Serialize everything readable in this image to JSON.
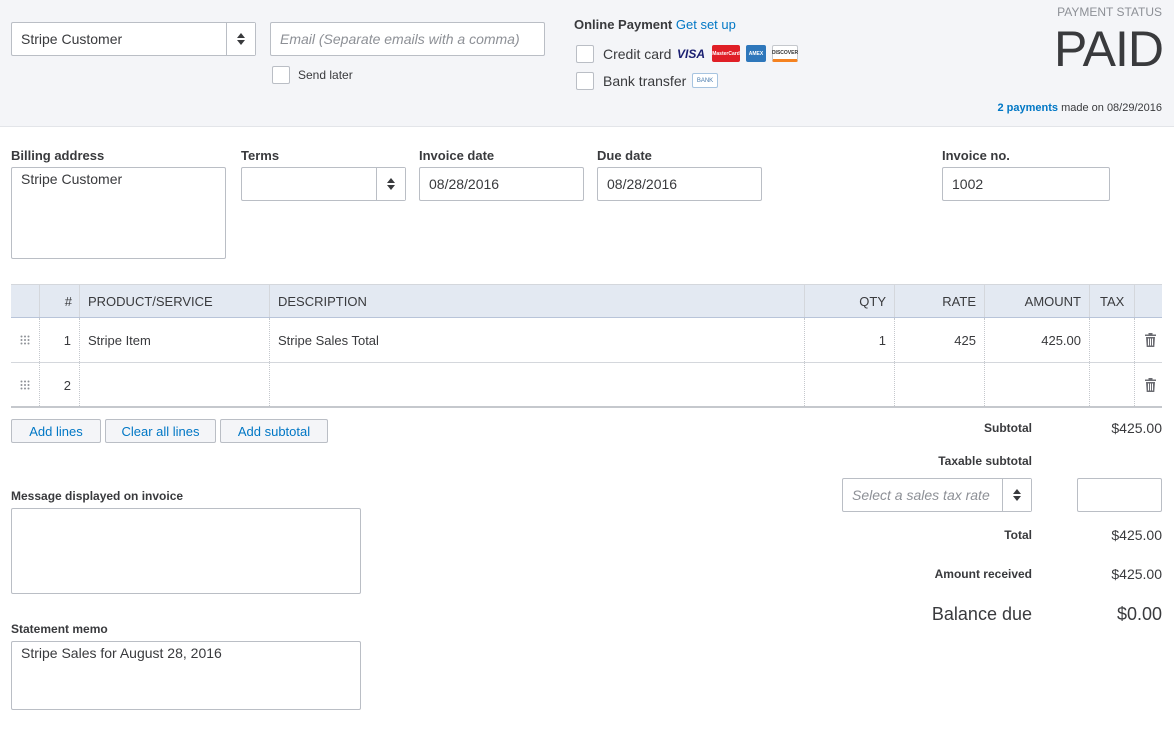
{
  "customer": {
    "value": "Stripe Customer"
  },
  "email": {
    "placeholder": "Email (Separate emails with a comma)",
    "send_later": "Send later"
  },
  "online_payment": {
    "title": "Online Payment",
    "setup_link": "Get set up",
    "credit_card": "Credit card",
    "bank_transfer": "Bank transfer",
    "card_logos": [
      "VISA",
      "MasterCard",
      "AMEX",
      "DISCOVER"
    ],
    "bank_logo": "BANK"
  },
  "status": {
    "label": "PAYMENT STATUS",
    "value": "PAID",
    "payments_link": "2 payments",
    "made_on": "made on 08/29/2016"
  },
  "fields": {
    "billing_label": "Billing address",
    "billing_value": "Stripe Customer",
    "terms_label": "Terms",
    "terms_value": "",
    "invoice_date_label": "Invoice date",
    "invoice_date_value": "08/28/2016",
    "due_date_label": "Due date",
    "due_date_value": "08/28/2016",
    "invoice_no_label": "Invoice no.",
    "invoice_no_value": "1002"
  },
  "table": {
    "headers": {
      "num": "#",
      "product": "PRODUCT/SERVICE",
      "description": "DESCRIPTION",
      "qty": "QTY",
      "rate": "RATE",
      "amount": "AMOUNT",
      "tax": "TAX"
    },
    "rows": [
      {
        "num": "1",
        "product": "Stripe Item",
        "description": "Stripe Sales Total",
        "qty": "1",
        "rate": "425",
        "amount": "425.00"
      },
      {
        "num": "2",
        "product": "",
        "description": "",
        "qty": "",
        "rate": "",
        "amount": ""
      }
    ]
  },
  "buttons": {
    "add_lines": "Add lines",
    "clear_lines": "Clear all lines",
    "add_subtotal": "Add subtotal"
  },
  "totals": {
    "subtotal_label": "Subtotal",
    "subtotal_value": "$425.00",
    "taxable_label": "Taxable subtotal",
    "tax_rate_placeholder": "Select a sales tax rate",
    "total_label": "Total",
    "total_value": "$425.00",
    "received_label": "Amount received",
    "received_value": "$425.00",
    "balance_label": "Balance due",
    "balance_value": "$0.00"
  },
  "message": {
    "label": "Message displayed on invoice",
    "value": ""
  },
  "memo": {
    "label": "Statement memo",
    "value": "Stripe Sales for August 28, 2016"
  },
  "colors": {
    "link": "#0077c5",
    "header_bg": "#f4f5f8",
    "table_head_bg": "#e3e9f2"
  }
}
